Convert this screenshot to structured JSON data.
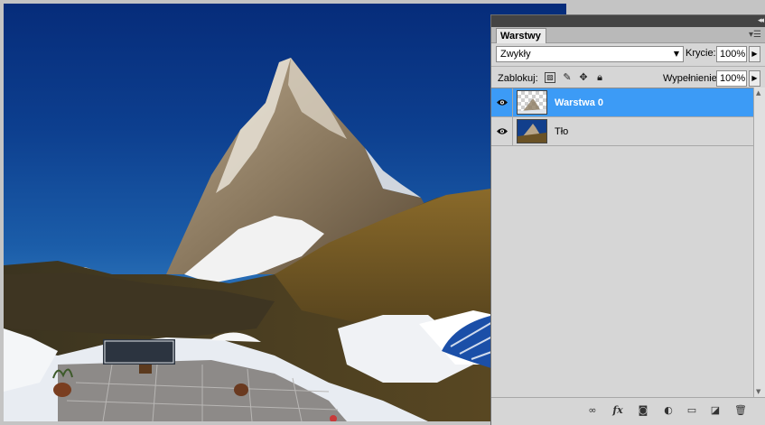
{
  "panel": {
    "tab_label": "Warstwy",
    "blend_mode": "Zwykły",
    "opacity_label": "Krycie:",
    "opacity_value": "100%",
    "lock_label": "Zablokuj:",
    "fill_label": "Wypełnienie:",
    "fill_value": "100%"
  },
  "layers": [
    {
      "name": "Warstwa 0",
      "selected": true,
      "visible": true
    },
    {
      "name": "Tło",
      "selected": false,
      "visible": true
    }
  ],
  "colors": {
    "selection": "#3c9bf6",
    "panel_bg": "#d6d6d6",
    "sky": "#0d3f8f"
  },
  "icons": {
    "eye": "eye-icon",
    "link": "link-icon",
    "fx": "fx-icon",
    "mask": "layer-mask-icon",
    "adjust": "adjustment-layer-icon",
    "folder": "group-folder-icon",
    "new_layer": "new-layer-icon",
    "trash": "trash-icon"
  }
}
